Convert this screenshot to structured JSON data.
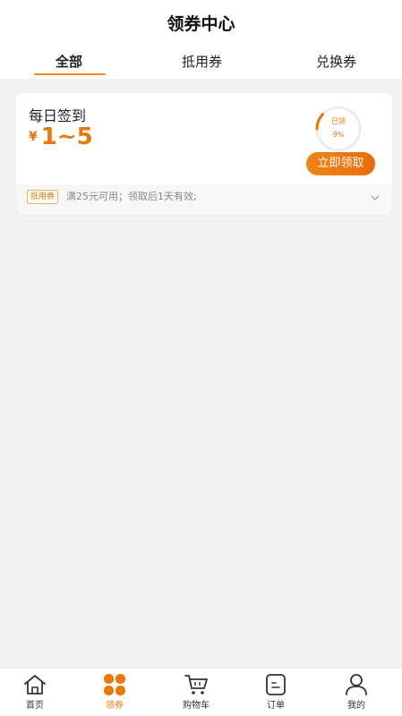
{
  "header": {
    "title": "领券中心",
    "tabs": [
      {
        "label": "全部",
        "active": true
      },
      {
        "label": "抵用券",
        "active": false
      },
      {
        "label": "兑换券",
        "active": false
      }
    ]
  },
  "coupon": {
    "title": "每日签到",
    "currency": "¥",
    "amount": "1~5",
    "progress_label": "已领",
    "progress_text": "9%",
    "progress_value": 0.09,
    "claim_label": "立即领取",
    "tag": "抵用券",
    "rule": "满25元可用；领取后1天有效;"
  },
  "colors": {
    "accent": "#e9780c",
    "background": "#f2f2f2"
  },
  "tabbar": {
    "items": [
      {
        "label": "首页",
        "icon": "home-icon",
        "active": false
      },
      {
        "label": "领券",
        "icon": "clover-icon",
        "active": true
      },
      {
        "label": "购物车",
        "icon": "cart-icon",
        "active": false
      },
      {
        "label": "订单",
        "icon": "order-icon",
        "active": false
      },
      {
        "label": "我的",
        "icon": "user-icon",
        "active": false
      }
    ]
  }
}
